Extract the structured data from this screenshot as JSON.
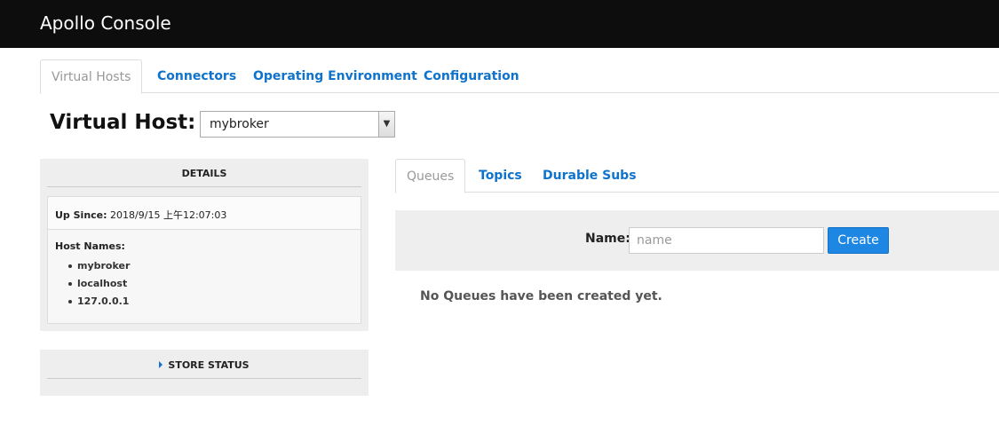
{
  "app": {
    "title": "Apollo Console"
  },
  "main_tabs": [
    {
      "label": "Virtual Hosts"
    },
    {
      "label": "Connectors"
    },
    {
      "label": "Operating Environment"
    },
    {
      "label": "Configuration"
    }
  ],
  "virtual_host": {
    "label": "Virtual Host:",
    "selected": "mybroker"
  },
  "details": {
    "title": "DETAILS",
    "up_since_label": "Up Since:",
    "up_since_value": "2018/9/15 上午12:07:03",
    "host_names_label": "Host Names:",
    "host_names": [
      "mybroker",
      "localhost",
      "127.0.0.1"
    ]
  },
  "store_status": {
    "title": "STORE STATUS"
  },
  "sub_tabs": [
    {
      "label": "Queues"
    },
    {
      "label": "Topics"
    },
    {
      "label": "Durable Subs"
    }
  ],
  "create": {
    "name_label": "Name:",
    "name_placeholder": "name",
    "button_label": "Create"
  },
  "empty_message": "No Queues have been created yet.",
  "colors": {
    "topbar": "#0d0d0d",
    "link": "#0f73cc",
    "button": "#1d87e3"
  }
}
